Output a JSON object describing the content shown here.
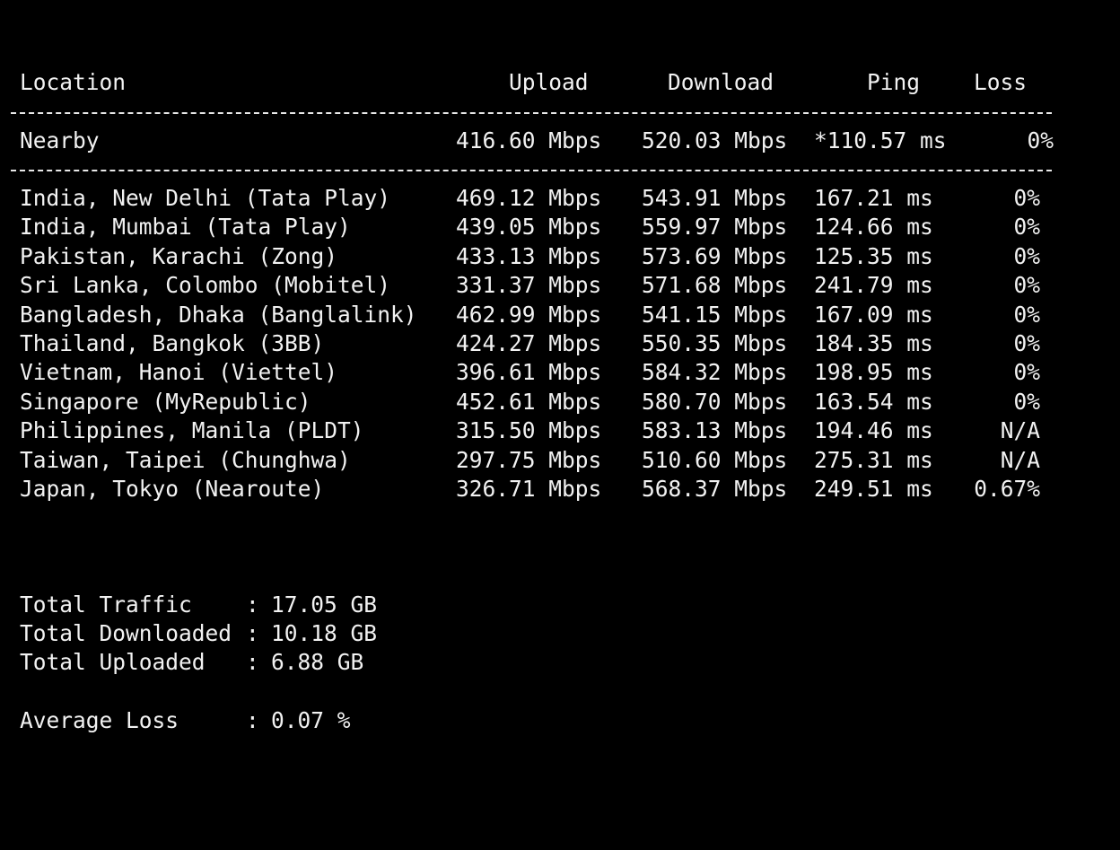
{
  "header": {
    "location": "Location",
    "upload": "Upload",
    "download": "Download",
    "ping": "Ping",
    "loss": "Loss"
  },
  "nearby": {
    "location": "Nearby",
    "upload": "416.60 Mbps",
    "download": "520.03 Mbps",
    "ping": "*110.57 ms",
    "loss": "0%"
  },
  "rows": [
    {
      "location": "India, New Delhi (Tata Play)",
      "upload": "469.12 Mbps",
      "download": "543.91 Mbps",
      "ping": "167.21 ms",
      "loss": "0%"
    },
    {
      "location": "India, Mumbai (Tata Play)",
      "upload": "439.05 Mbps",
      "download": "559.97 Mbps",
      "ping": "124.66 ms",
      "loss": "0%"
    },
    {
      "location": "Pakistan, Karachi (Zong)",
      "upload": "433.13 Mbps",
      "download": "573.69 Mbps",
      "ping": "125.35 ms",
      "loss": "0%"
    },
    {
      "location": "Sri Lanka, Colombo (Mobitel)",
      "upload": "331.37 Mbps",
      "download": "571.68 Mbps",
      "ping": "241.79 ms",
      "loss": "0%"
    },
    {
      "location": "Bangladesh, Dhaka (Banglalink)",
      "upload": "462.99 Mbps",
      "download": "541.15 Mbps",
      "ping": "167.09 ms",
      "loss": "0%"
    },
    {
      "location": "Thailand, Bangkok (3BB)",
      "upload": "424.27 Mbps",
      "download": "550.35 Mbps",
      "ping": "184.35 ms",
      "loss": "0%"
    },
    {
      "location": "Vietnam, Hanoi (Viettel)",
      "upload": "396.61 Mbps",
      "download": "584.32 Mbps",
      "ping": "198.95 ms",
      "loss": "0%"
    },
    {
      "location": "Singapore (MyRepublic)",
      "upload": "452.61 Mbps",
      "download": "580.70 Mbps",
      "ping": "163.54 ms",
      "loss": "0%"
    },
    {
      "location": "Philippines, Manila (PLDT)",
      "upload": "315.50 Mbps",
      "download": "583.13 Mbps",
      "ping": "194.46 ms",
      "loss": "N/A"
    },
    {
      "location": "Taiwan, Taipei (Chunghwa)",
      "upload": "297.75 Mbps",
      "download": "510.60 Mbps",
      "ping": "275.31 ms",
      "loss": "N/A"
    },
    {
      "location": "Japan, Tokyo (Nearoute)",
      "upload": "326.71 Mbps",
      "download": "568.37 Mbps",
      "ping": "249.51 ms",
      "loss": "0.67%"
    }
  ],
  "summary": [
    {
      "key": "Total Traffic",
      "colon": ":",
      "value": "17.05 GB"
    },
    {
      "key": "Total Downloaded",
      "colon": ":",
      "value": "10.18 GB"
    },
    {
      "key": "Total Uploaded",
      "colon": ":",
      "value": "6.88 GB"
    },
    {
      "key": "Average Loss",
      "colon": ":",
      "value": "0.07 %"
    }
  ],
  "colors": {
    "background": "#000000",
    "text": "#f2f2f2"
  }
}
